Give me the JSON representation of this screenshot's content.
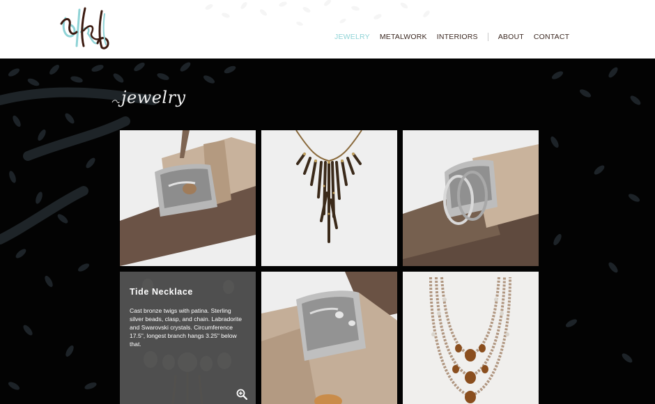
{
  "nav": {
    "items": [
      {
        "label": "JEWELRY",
        "active": true
      },
      {
        "label": "METALWORK",
        "active": false
      },
      {
        "label": "INTERIORS",
        "active": false
      },
      {
        "label": "ABOUT",
        "active": false
      },
      {
        "label": "CONTACT",
        "active": false
      }
    ]
  },
  "section": {
    "title": "jewelry"
  },
  "gallery": {
    "items": [
      {
        "subject": "cuff bracelet on driftwood",
        "icon": "bracelet-photo"
      },
      {
        "subject": "twig bib necklace",
        "icon": "necklace-photo"
      },
      {
        "subject": "cuff bracelet on driftwood",
        "icon": "bracelet-photo"
      },
      {
        "subject": "tide necklace",
        "icon": "necklace-photo",
        "caption_title": "Tide Necklace",
        "caption_text": "Cast bronze twigs with patina. Sterling silver beads, clasp, and chain. Labradorite and Swarovski crystals. Circumference 17.5\", longest branch hangs 3.25\" below that."
      },
      {
        "subject": "cuff bracelet on driftwood",
        "icon": "bracelet-photo"
      },
      {
        "subject": "beaded multi-strand necklace",
        "icon": "necklace-photo"
      }
    ]
  },
  "colors": {
    "accent": "#8fd3d6",
    "nav_text": "#3a2720",
    "background": "#030303"
  }
}
